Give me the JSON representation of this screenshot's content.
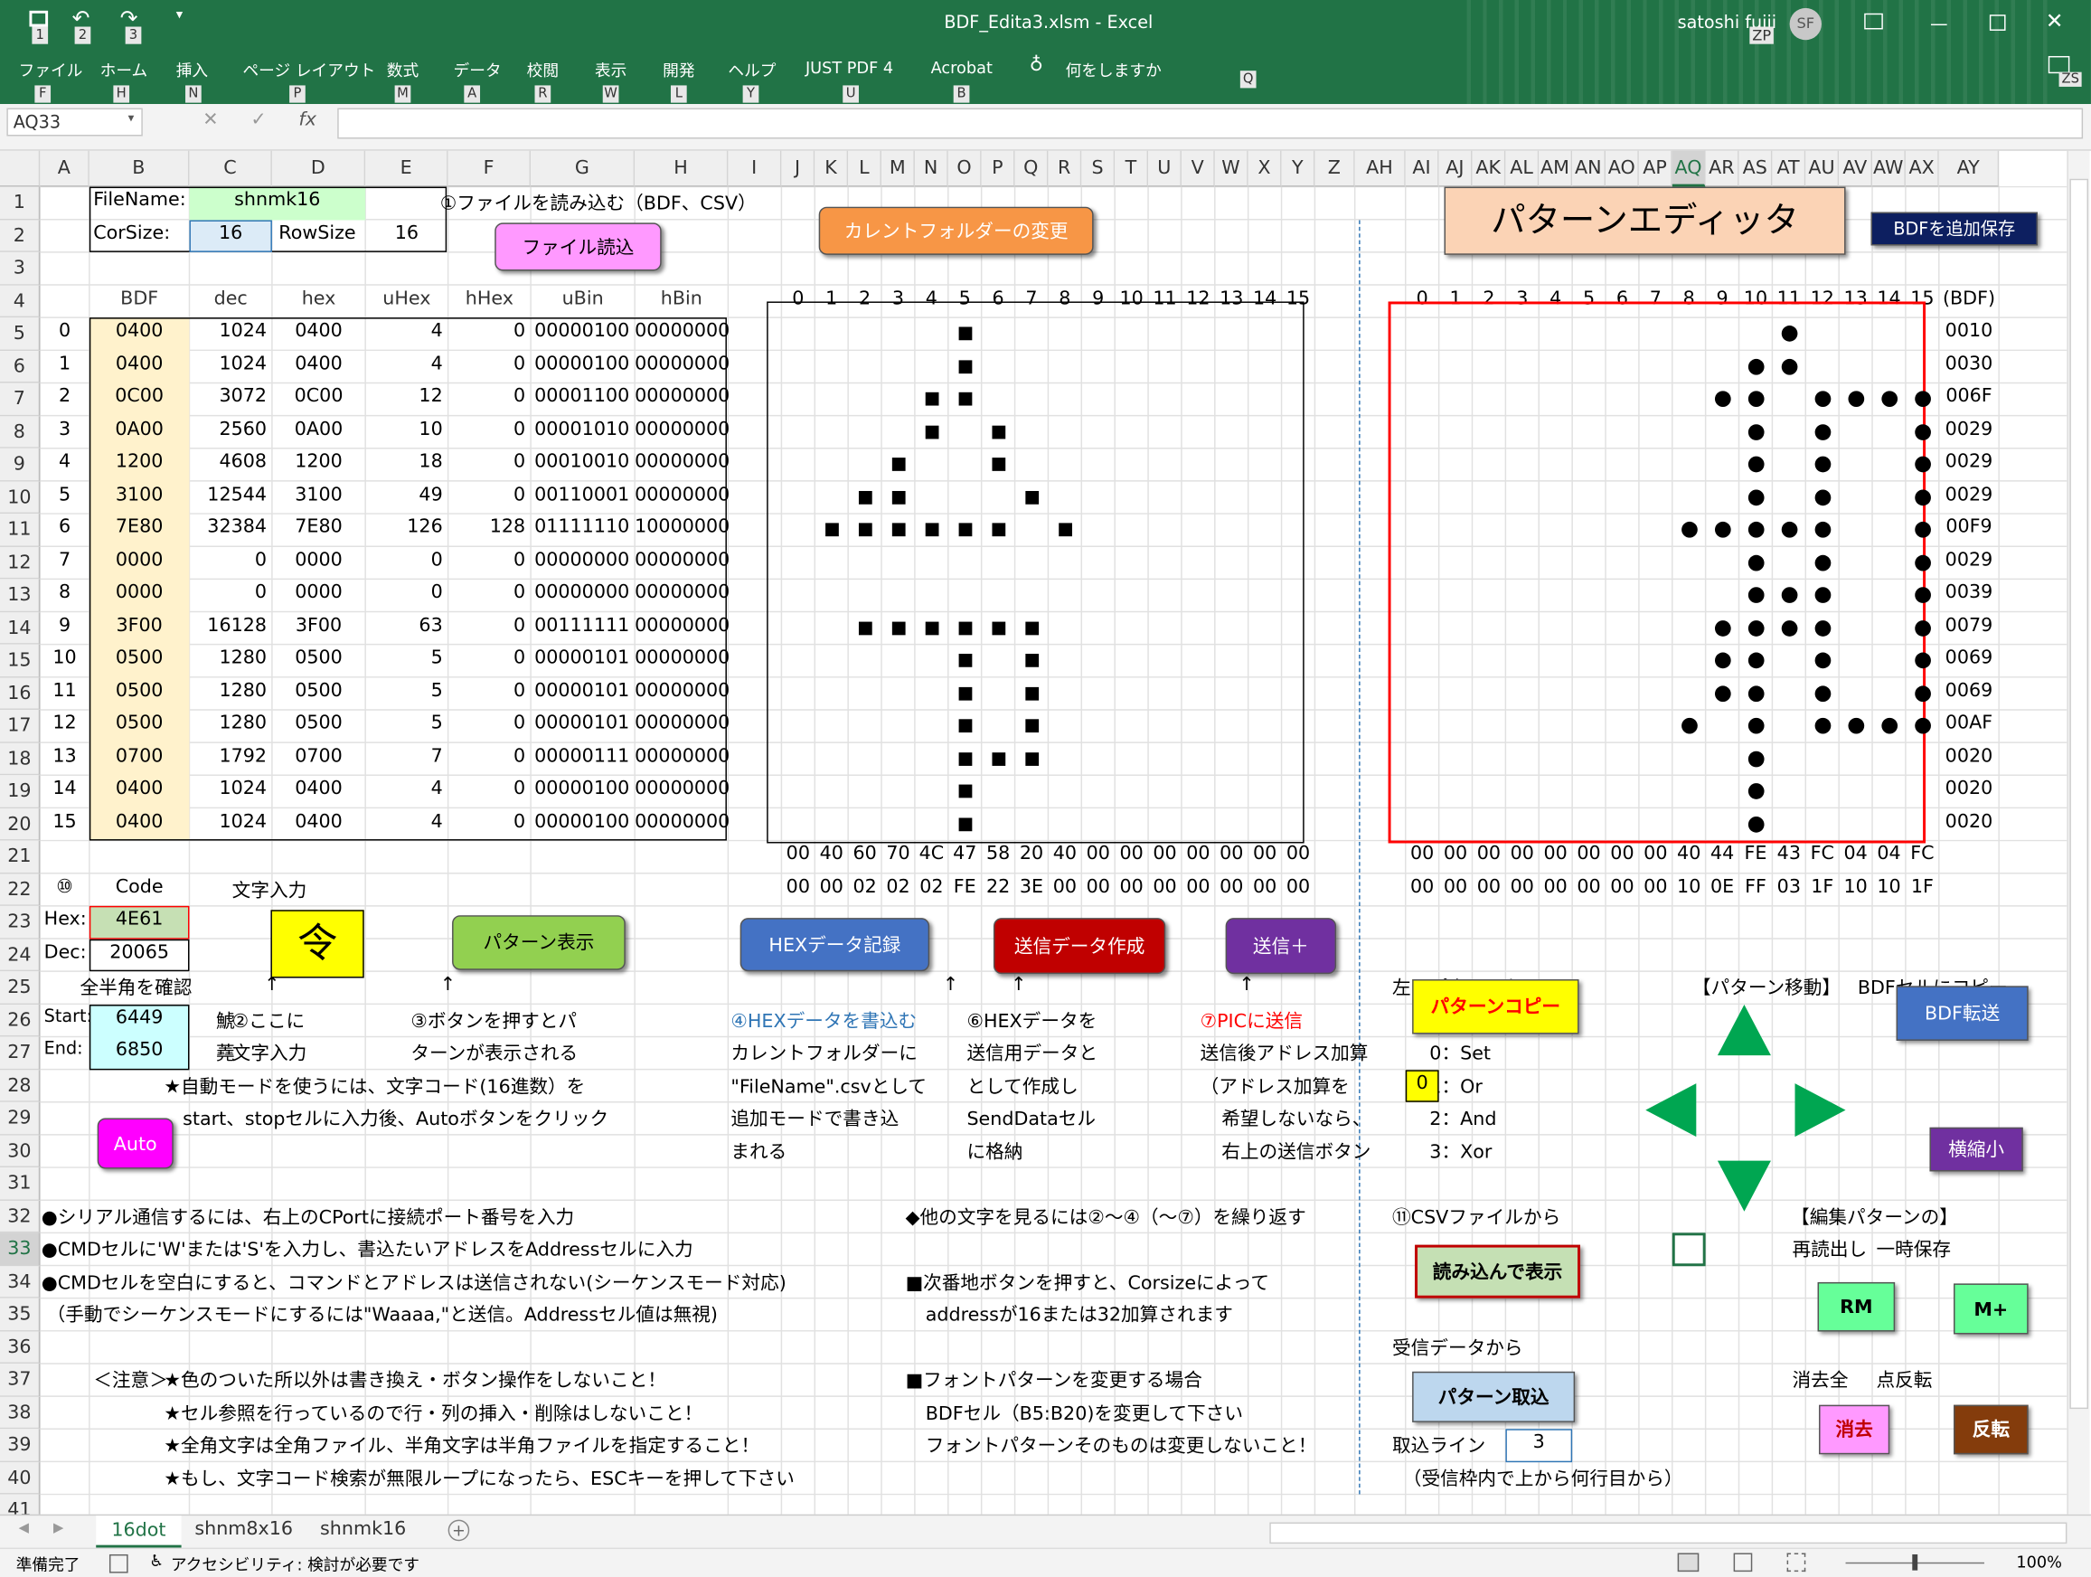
{
  "title": {
    "file": "BDF_Edita3.xlsm - Excel",
    "user": "satoshi fujii",
    "initials": "SF",
    "zp": "ZP",
    "zs": "ZS"
  },
  "ribbon": [
    "ファイル",
    "ホーム",
    "挿入",
    "ページ レイアウト",
    "数式",
    "データ",
    "校閲",
    "表示",
    "開発",
    "ヘルプ",
    "JUST PDF 4",
    "Acrobat",
    "何をしますか"
  ],
  "keytips": [
    "F",
    "H",
    "N",
    "P",
    "M",
    "A",
    "R",
    "W",
    "L",
    "Y",
    "U",
    "B",
    "Q"
  ],
  "qat_keys": [
    "1",
    "2",
    "3"
  ],
  "namebox": "AQ33",
  "formula_icons": {
    "x": "✕",
    "check": "✓",
    "fx": "fx"
  },
  "cols": [
    "A",
    "B",
    "C",
    "D",
    "E",
    "F",
    "G",
    "H",
    "I",
    "J",
    "K",
    "L",
    "M",
    "N",
    "O",
    "P",
    "Q",
    "R",
    "S",
    "T",
    "U",
    "V",
    "W",
    "X",
    "Y",
    "Z",
    "AH",
    "AI",
    "AJ",
    "AK",
    "AL",
    "AM",
    "AN",
    "AO",
    "AP",
    "AQ",
    "AR",
    "AS",
    "AT",
    "AU",
    "AV",
    "AW",
    "AX",
    "AY"
  ],
  "rows": [
    "1",
    "2",
    "3",
    "4",
    "5",
    "6",
    "7",
    "8",
    "9",
    "10",
    "11",
    "12",
    "13",
    "14",
    "15",
    "16",
    "17",
    "18",
    "19",
    "20",
    "21",
    "22",
    "23",
    "24",
    "25",
    "26",
    "27",
    "28",
    "29",
    "30",
    "31",
    "32",
    "33",
    "34",
    "35",
    "36",
    "37",
    "38",
    "39",
    "40",
    "41"
  ],
  "header": {
    "filename_label": "FileName:",
    "filename": "shnmk16",
    "corsize_label": "CorSize:",
    "corsize": "16",
    "rowsize_label": "RowSize",
    "rowsize": "16",
    "read_note": "①ファイルを読み込む（BDF、CSV）"
  },
  "table_headers": [
    "BDF",
    "dec",
    "hex",
    "uHex",
    "hHex",
    "uBin",
    "hBin"
  ],
  "table": [
    [
      "0",
      "0400",
      "1024",
      "0400",
      "4",
      "0",
      "00000100",
      "00000000"
    ],
    [
      "1",
      "0400",
      "1024",
      "0400",
      "4",
      "0",
      "00000100",
      "00000000"
    ],
    [
      "2",
      "0C00",
      "3072",
      "0C00",
      "12",
      "0",
      "00001100",
      "00000000"
    ],
    [
      "3",
      "0A00",
      "2560",
      "0A00",
      "10",
      "0",
      "00001010",
      "00000000"
    ],
    [
      "4",
      "1200",
      "4608",
      "1200",
      "18",
      "0",
      "00010010",
      "00000000"
    ],
    [
      "5",
      "3100",
      "12544",
      "3100",
      "49",
      "0",
      "00110001",
      "00000000"
    ],
    [
      "6",
      "7E80",
      "32384",
      "7E80",
      "126",
      "128",
      "01111110",
      "10000000"
    ],
    [
      "7",
      "0000",
      "0",
      "0000",
      "0",
      "0",
      "00000000",
      "00000000"
    ],
    [
      "8",
      "0000",
      "0",
      "0000",
      "0",
      "0",
      "00000000",
      "00000000"
    ],
    [
      "9",
      "3F00",
      "16128",
      "3F00",
      "63",
      "0",
      "00111111",
      "00000000"
    ],
    [
      "10",
      "0500",
      "1280",
      "0500",
      "5",
      "0",
      "00000101",
      "00000000"
    ],
    [
      "11",
      "0500",
      "1280",
      "0500",
      "5",
      "0",
      "00000101",
      "00000000"
    ],
    [
      "12",
      "0500",
      "1280",
      "0500",
      "5",
      "0",
      "00000101",
      "00000000"
    ],
    [
      "13",
      "0700",
      "1792",
      "0700",
      "7",
      "0",
      "00000111",
      "00000000"
    ],
    [
      "14",
      "0400",
      "1024",
      "0400",
      "4",
      "0",
      "00000100",
      "00000000"
    ],
    [
      "15",
      "0400",
      "1024",
      "0400",
      "4",
      "0",
      "00000100",
      "00000000"
    ]
  ],
  "bits": [
    "0",
    "1",
    "2",
    "3",
    "4",
    "5",
    "6",
    "7",
    "8",
    "9",
    "10",
    "11",
    "12",
    "13",
    "14",
    "15"
  ],
  "left_bottom1": [
    "00",
    "40",
    "60",
    "70",
    "4C",
    "47",
    "58",
    "20",
    "40",
    "00",
    "00",
    "00",
    "00",
    "00",
    "00",
    "00"
  ],
  "left_bottom2": [
    "00",
    "00",
    "02",
    "02",
    "02",
    "FE",
    "22",
    "3E",
    "00",
    "00",
    "00",
    "00",
    "00",
    "00",
    "00",
    "00"
  ],
  "right_bottom1": [
    "00",
    "00",
    "00",
    "00",
    "00",
    "00",
    "00",
    "00",
    "40",
    "44",
    "FE",
    "43",
    "FC",
    "04",
    "04",
    "FC"
  ],
  "right_bottom2": [
    "00",
    "00",
    "00",
    "00",
    "00",
    "00",
    "00",
    "00",
    "10",
    "0E",
    "FF",
    "03",
    "1F",
    "10",
    "10",
    "1F"
  ],
  "bdf_label": "(BDF)",
  "right_bdf": [
    "0010",
    "0030",
    "006F",
    "0029",
    "0029",
    "0029",
    "00F9",
    "0029",
    "0039",
    "0079",
    "0069",
    "0069",
    "00AF",
    "0020",
    "0020",
    "0020"
  ],
  "left_pattern": [
    "0400",
    "0400",
    "0C00",
    "0A00",
    "1200",
    "3100",
    "7E80",
    "0000",
    "0000",
    "3F00",
    "0500",
    "0500",
    "0500",
    "0700",
    "0400",
    "0400"
  ],
  "right_pattern": [
    "0010",
    "0030",
    "006F",
    "0029",
    "0029",
    "0029",
    "00F9",
    "0029",
    "0039",
    "0079",
    "0069",
    "0069",
    "00AF",
    "0020",
    "0020",
    "0020"
  ],
  "code": {
    "num": "⑩",
    "label": "Code",
    "input_label": "文字入力",
    "hex_label": "Hex:",
    "hex": "4E61",
    "dec_label": "Dec:",
    "dec": "20065",
    "char": "令",
    "check": "全半角を確認",
    "start_label": "Start:",
    "start": "6449",
    "start_char": "鯱",
    "end_label": "End:",
    "end": "6850",
    "end_char": "蕘"
  },
  "buttons": {
    "file_read": "ファイル読込",
    "folder": "カレントフォルダーの変更",
    "editor": "パターンエディッタ",
    "bdf_save": "BDFを追加保存",
    "pattern_show": "パターン表示",
    "hex_write": "HEXデータ記録",
    "send_make": "送信データ作成",
    "send_plus": "送信＋",
    "auto": "Auto",
    "pattern_copy": "パターンコピー",
    "bdf_transfer": "BDF転送",
    "shrink": "横縮小",
    "load_show": "読み込んで表示",
    "pattern_get": "パターン取込",
    "rm": "RM",
    "mplus": "M+",
    "erase": "消去",
    "invert": "反転"
  },
  "arrows": [
    "↑",
    "↑",
    "↑",
    "↑",
    "↑"
  ],
  "notes": {
    "n26": "②ここに",
    "n27": "文字入力",
    "p26": "③ボタンを押すとパ",
    "p27": "ターンが表示される",
    "h26": "④HEXデータを書込む",
    "h27": "カレントフォルダーに",
    "h28": "\"FileName\".csvとして",
    "h29": "追加モードで書き込",
    "h30": "まれる",
    "s26": "⑥HEXデータを",
    "s27": "送信用データと",
    "s28": "として作成し",
    "s29": "SendDataセル",
    "s30": "に格納",
    "t26": "⑦PICに送信",
    "t27": "送信後アドレス加算",
    "t28": "（アドレス加算を",
    "t29": "希望しないなら、",
    "t30": "右上の送信ボタン",
    "auto1": "★自動モードを使うには、文字コード(16進数）を",
    "auto2": "start、stopセルに入力後、Autoボタンをクリック",
    "l32": "●シリアル通信するには、右上のCPortに接続ポート番号を入力",
    "l33": "●CMDセルに'W'または'S'を入力し、書込たいアドレスをAddressセルに入力",
    "l34": "●CMDセルを空白にすると、コマンドとアドレスは送信されない(シーケンスモード対応)",
    "l35": "（手動でシーケンスモードにするには\"Waaaa,\"と送信。Addressセル値は無視)",
    "m32": "◆他の文字を見るには②～④（～⑦）を繰り返す",
    "m34": "■次番地ボタンを押すと、Corsizeによって",
    "m35": "addressが16または32加算されます",
    "c37": "＜注意＞",
    "w37": "★色のついた所以外は書き換え・ボタン操作をしないこと！",
    "w38": "★セル参照を行っているので行・列の挿入・削除はしないこと！",
    "w39": "★全角文字は全角ファイル、半角文字は半角ファイルを指定すること！",
    "w40": "★もし、文字コード検索が無限ループになったら、ESCキーを押して下さい",
    "f37": "■フォントパターンを変更する場合",
    "f38": "BDFセル（B5:B20)を変更して下さい",
    "f39": "フォントパターンそのものは変更しないこと！",
    "left_pat": "左のパターンを",
    "move": "【パターン移動】",
    "bdfcopy": "BDFセルにコピー",
    "op0": "0：Set",
    "op1": "1：Or",
    "op2": "2：And",
    "op3": "3：Xor",
    "opval": "0",
    "csv": "⑪CSVファイルから",
    "edit": "【編集パターンの】",
    "reread": "再読出し",
    "tmpsave": "一時保存",
    "recv": "受信データから",
    "erase_all": "消去全",
    "invert_pt": "点反転",
    "line_label": "取込ライン",
    "line_val": "3",
    "line_note": "（受信枠内で上から何行目から）"
  },
  "sheets": [
    "16dot",
    "shnm8x16",
    "shnmk16"
  ],
  "status": {
    "ready": "準備完了",
    "access": "アクセシビリティ: 検討が必要です",
    "zoom": "100%"
  }
}
